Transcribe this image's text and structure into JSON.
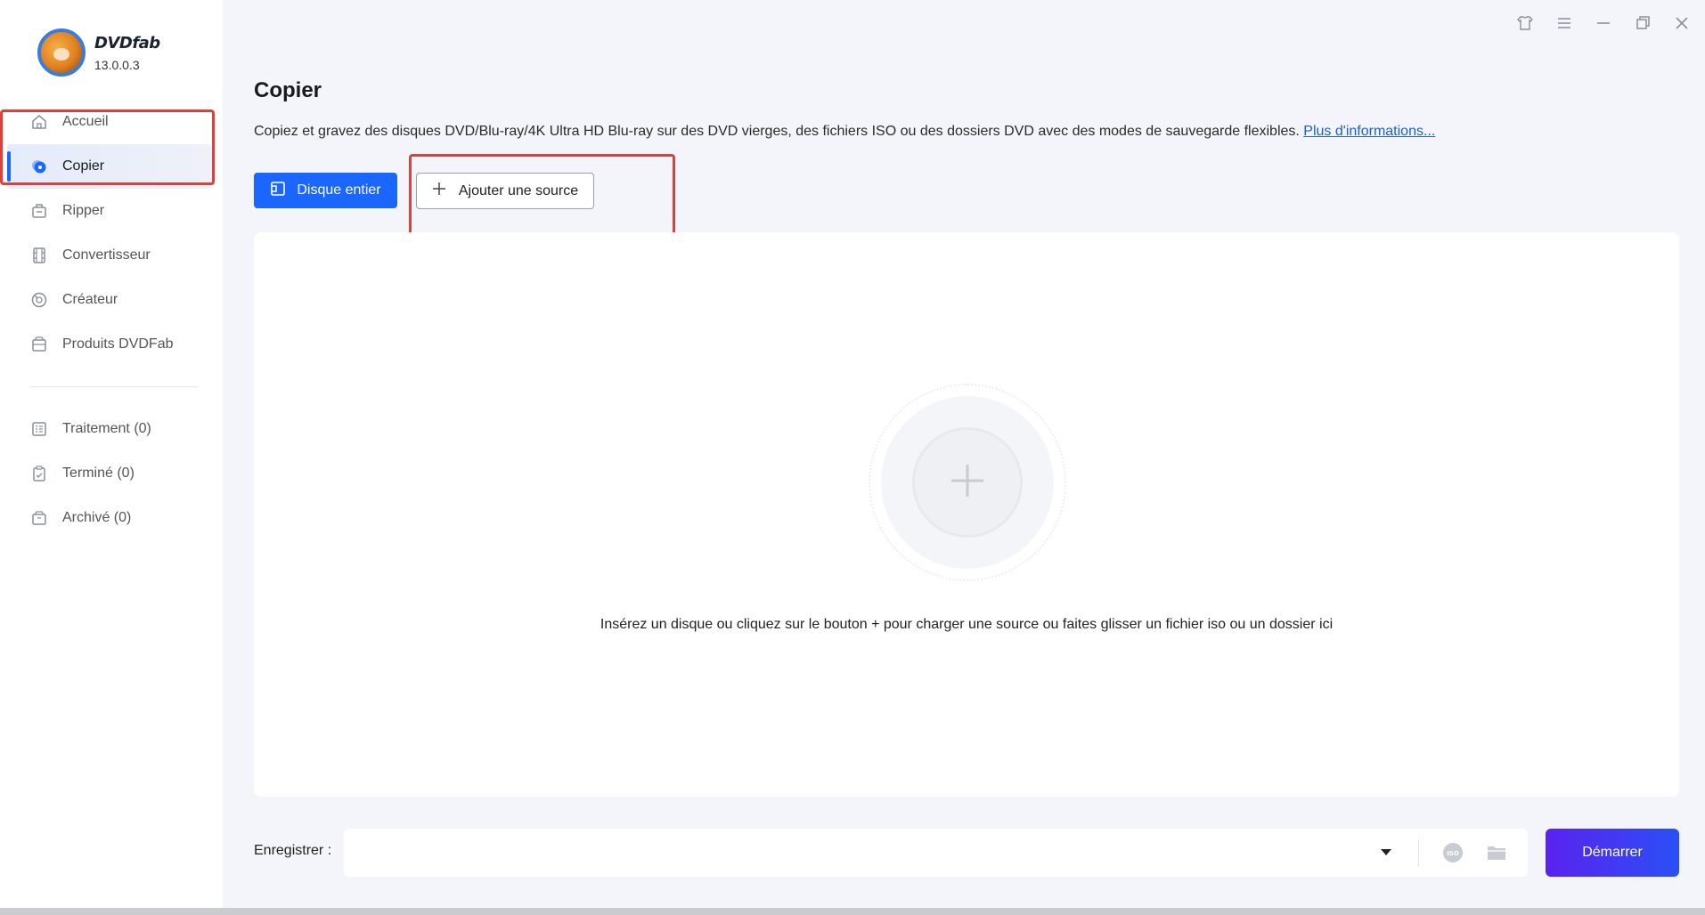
{
  "app": {
    "name": "DVDfab",
    "version": "13.0.0.3"
  },
  "sidebar": {
    "items": [
      {
        "label": "Accueil",
        "icon": "home-icon"
      },
      {
        "label": "Copier",
        "icon": "copy-disc-icon",
        "active": true
      },
      {
        "label": "Ripper",
        "icon": "ripper-icon"
      },
      {
        "label": "Convertisseur",
        "icon": "film-icon"
      },
      {
        "label": "Créateur",
        "icon": "creator-icon"
      },
      {
        "label": "Produits DVDFab",
        "icon": "products-icon"
      }
    ],
    "task_items": [
      {
        "label": "Traitement (0)",
        "icon": "list-icon"
      },
      {
        "label": "Terminé (0)",
        "icon": "clipboard-icon"
      },
      {
        "label": "Archivé (0)",
        "icon": "archive-icon"
      }
    ]
  },
  "window_controls": [
    "shirt-icon",
    "menu-icon",
    "minimize-icon",
    "restore-icon",
    "close-icon"
  ],
  "main": {
    "title": "Copier",
    "description": "Copiez et gravez des disques DVD/Blu-ray/4K Ultra HD Blu-ray sur des DVD vierges, des fichiers ISO ou des dossiers DVD avec des modes de sauvegarde flexibles.",
    "more_info_link": "Plus d'informations...",
    "mode_button": "Disque entier",
    "add_source_button": "Ajouter une source",
    "drop_hint": "Insérez un disque ou cliquez sur le bouton +  pour charger une source ou faites glisser un fichier iso ou un dossier ici"
  },
  "footer": {
    "save_label": "Enregistrer :",
    "save_value": "",
    "start_button": "Démarrer"
  },
  "colors": {
    "primary": "#1a66ff",
    "highlight": "#e0403a",
    "start_gradient_from": "#5a22f0",
    "start_gradient_to": "#2b4ff5"
  }
}
